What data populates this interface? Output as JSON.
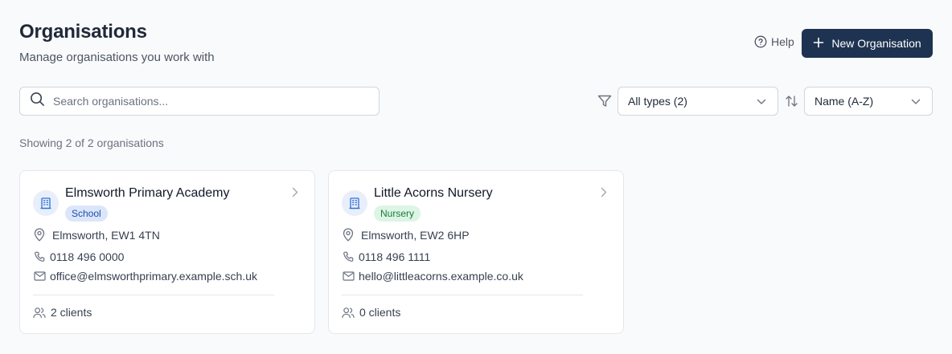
{
  "header": {
    "title": "Organisations",
    "subtitle": "Manage organisations you work with",
    "help_label": "Help",
    "help_icon": "question-circle-icon",
    "new_button_label": "New Organisation",
    "new_button_icon": "plus-icon",
    "accent_color": "#1e3351"
  },
  "toolbar": {
    "search_placeholder": "Search organisations...",
    "search_value": "",
    "type_filter": "All types (2)",
    "sort": "Name (A-Z)"
  },
  "summary": "Showing 2 of 2 organisations",
  "organisations": [
    {
      "name": "Elmsworth Primary Academy",
      "type": "School",
      "type_color": "#dbe6fb",
      "location": "Elmsworth, EW1 4TN",
      "phone": "0118 496 0000",
      "email": "office@elmsworthprimary.example.sch.uk",
      "clients": "2 clients"
    },
    {
      "name": "Little Acorns Nursery",
      "type": "Nursery",
      "type_color": "#dcf5e4",
      "location": "Elmsworth, EW2 6HP",
      "phone": "0118 496 1111",
      "email": "hello@littleacorns.example.co.uk",
      "clients": "0 clients"
    }
  ]
}
